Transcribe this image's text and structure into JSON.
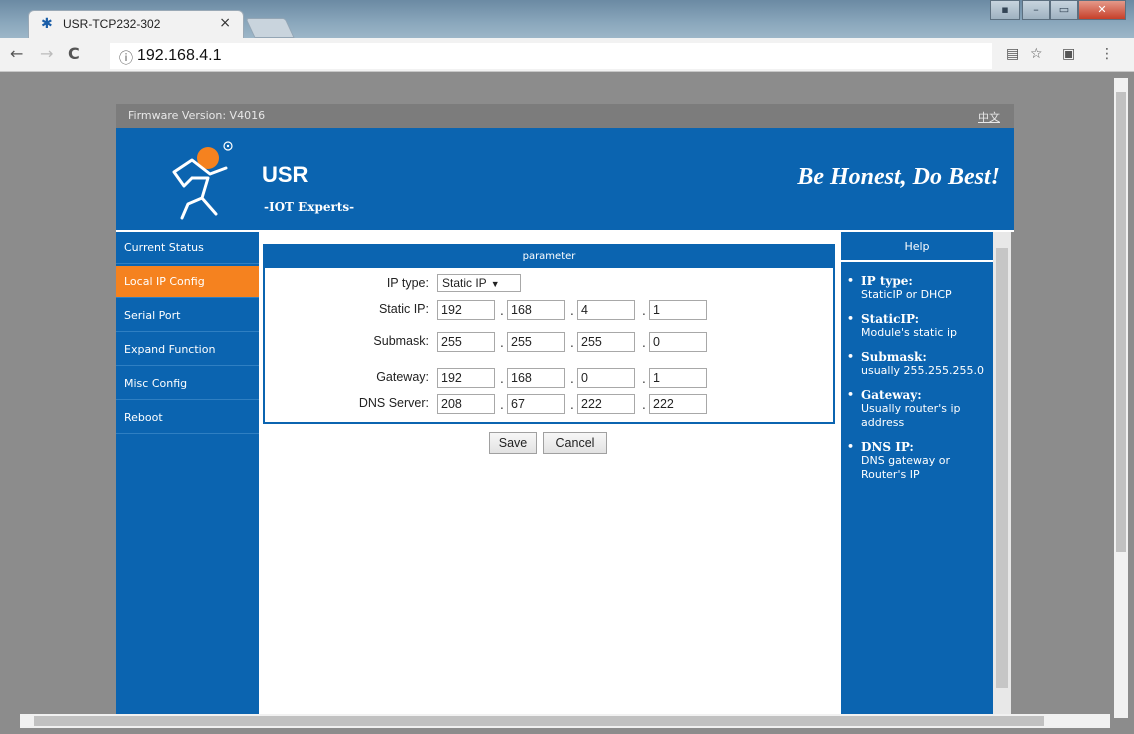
{
  "browser": {
    "tab_title": "USR-TCP232-302",
    "tab_close": "×",
    "url": "192.168.4.1",
    "info_icon": "info-icon",
    "back": "←",
    "forward": "→",
    "reload": "C"
  },
  "header": {
    "firmware_label": "Firmware Version:  V4016",
    "language_link": "中文",
    "brand": "USR",
    "brand_sub": "-IOT Experts-",
    "slogan": "Be Honest, Do Best!"
  },
  "sidebar": {
    "items": [
      {
        "label": "Current Status",
        "active": false
      },
      {
        "label": "Local IP Config",
        "active": true
      },
      {
        "label": "Serial Port",
        "active": false
      },
      {
        "label": "Expand Function",
        "active": false
      },
      {
        "label": "Misc Config",
        "active": false
      },
      {
        "label": "Reboot",
        "active": false
      }
    ]
  },
  "parameter": {
    "title": "parameter",
    "ip_type_label": "IP type:",
    "ip_type_value": "Static IP",
    "static_ip_label": "Static IP:",
    "static_ip": [
      "192",
      "168",
      "4",
      "1"
    ],
    "submask_label": "Submask:",
    "submask": [
      "255",
      "255",
      "255",
      "0"
    ],
    "gateway_label": "Gateway:",
    "gateway": [
      "192",
      "168",
      "0",
      "1"
    ],
    "dns_label": "DNS Server:",
    "dns": [
      "208",
      "67",
      "222",
      "222"
    ],
    "save": "Save",
    "cancel": "Cancel"
  },
  "help": {
    "title": "Help",
    "items": [
      {
        "title": "IP type:",
        "desc": "StaticIP or DHCP"
      },
      {
        "title": "StaticIP:",
        "desc": "Module's static ip"
      },
      {
        "title": "Submask:",
        "desc": "usually 255.255.255.0"
      },
      {
        "title": "Gateway:",
        "desc": "Usually router's ip address"
      },
      {
        "title": "DNS IP:",
        "desc": "DNS gateway or Router's IP"
      }
    ]
  },
  "colors": {
    "brand_blue": "#0b64b0",
    "active_orange": "#f5821f"
  }
}
